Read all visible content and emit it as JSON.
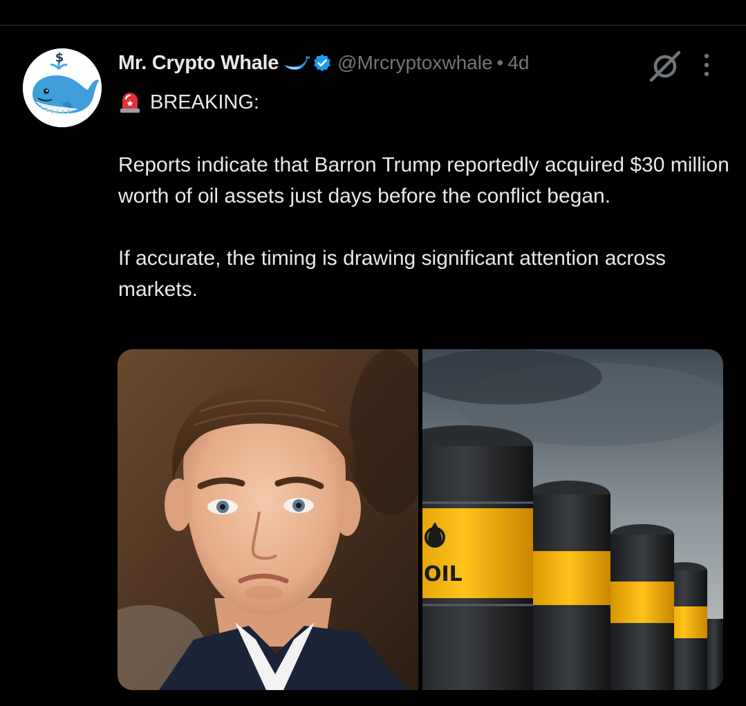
{
  "post": {
    "author": {
      "display_name": "Mr. Crypto Whale",
      "name_emoji_icon": "whale-emoji-icon",
      "verified_icon": "verified-badge-icon",
      "handle": "@Mrcryptoxwhale",
      "separator": "•",
      "time": "4d",
      "avatar": {
        "description_icon": "whale-avatar-icon",
        "symbol": "$"
      }
    },
    "actions": {
      "grok_icon": "grok-icon",
      "more_icon": "more-vertical-icon"
    },
    "breaking": {
      "icon": "siren-icon",
      "text": "BREAKING:"
    },
    "paragraphs": [
      "Reports indicate that Barron Trump reportedly acquired $30 million worth of oil assets just days before the conflict began.",
      "If accurate, the timing is drawing significant attention across markets."
    ],
    "media": {
      "left_image_icon": "portrait-photo",
      "right_image_icon": "oil-barrels-photo",
      "barrel_label": "OIL"
    }
  },
  "colors": {
    "background": "#000000",
    "text_primary": "#e7e9ea",
    "text_secondary": "#71767b",
    "verified_blue": "#1d9bf0",
    "divider": "#2f3336",
    "barrel_yellow": "#f2b400"
  }
}
